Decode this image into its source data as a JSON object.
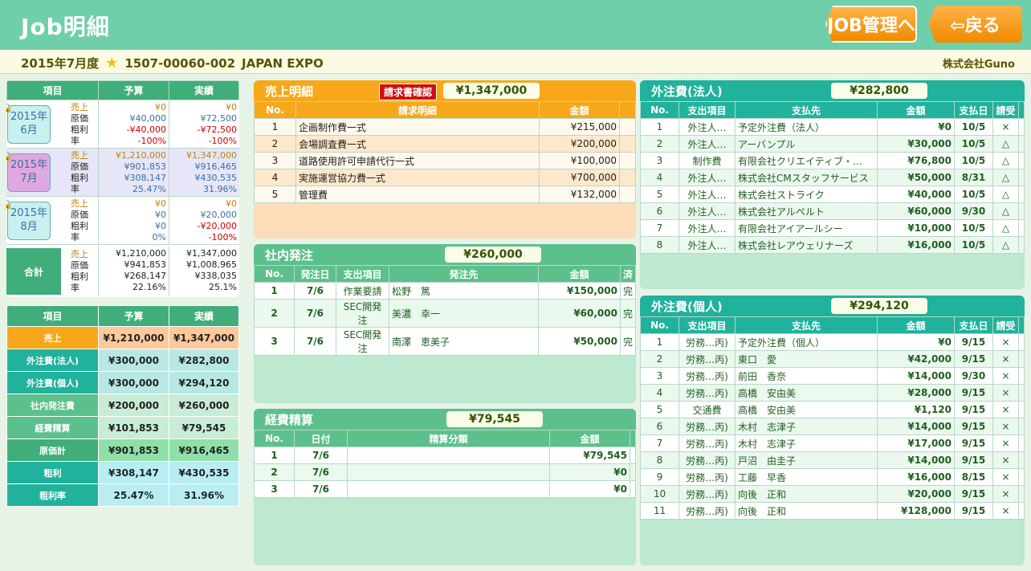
{
  "header": {
    "title": "Job明細",
    "job_button": "JOB管理へ",
    "back_button": "⇦戻る"
  },
  "subheader": {
    "period": "2015年7月度",
    "job_code": "1507-00060-002",
    "job_name": "JAPAN EXPO",
    "company": "株式会社Guno"
  },
  "month_table": {
    "headers": [
      "項目",
      "予算",
      "実績"
    ],
    "row_labels": [
      "売上",
      "原価",
      "粗利",
      "率"
    ],
    "months": [
      {
        "label": "2015年\n6月",
        "budget": [
          "¥0",
          "¥40,000",
          "-¥40,000",
          "-100%"
        ],
        "actual": [
          "¥0",
          "¥72,500",
          "-¥72,500",
          "-100%"
        ]
      },
      {
        "label": "2015年\n7月",
        "budget": [
          "¥1,210,000",
          "¥901,853",
          "¥308,147",
          "25.47%"
        ],
        "actual": [
          "¥1,347,000",
          "¥916,465",
          "¥430,535",
          "31.96%"
        ]
      },
      {
        "label": "2015年\n8月",
        "budget": [
          "¥0",
          "¥0",
          "¥0",
          "0%"
        ],
        "actual": [
          "¥0",
          "¥20,000",
          "-¥20,000",
          "-100%"
        ]
      }
    ],
    "total": {
      "label": "合計",
      "budget": [
        "¥1,210,000",
        "¥941,853",
        "¥268,147",
        "22.16%"
      ],
      "actual": [
        "¥1,347,000",
        "¥1,008,965",
        "¥338,035",
        "25.1%"
      ]
    }
  },
  "summary_table": {
    "headers": [
      "項目",
      "予算",
      "実績"
    ],
    "rows": [
      {
        "label": "売上",
        "budget": "¥1,210,000",
        "actual": "¥1,347,000"
      },
      {
        "label": "外注費(法人)",
        "budget": "¥300,000",
        "actual": "¥282,800"
      },
      {
        "label": "外注費(個人)",
        "budget": "¥300,000",
        "actual": "¥294,120"
      },
      {
        "label": "社内発注費",
        "budget": "¥200,000",
        "actual": "¥260,000"
      },
      {
        "label": "経費精算",
        "budget": "¥101,853",
        "actual": "¥79,545"
      },
      {
        "label": "原価計",
        "budget": "¥901,853",
        "actual": "¥916,465"
      },
      {
        "label": "粗利",
        "budget": "¥308,147",
        "actual": "¥430,535"
      },
      {
        "label": "粗利率",
        "budget": "25.47%",
        "actual": "31.96%"
      }
    ]
  },
  "sales": {
    "title": "売上明細",
    "invoice_button": "請求書確認",
    "total": "¥1,347,000",
    "headers": [
      "No.",
      "請求明細",
      "金額"
    ],
    "rows": [
      [
        "1",
        "企画制作費一式",
        "¥215,000"
      ],
      [
        "2",
        "会場調査費一式",
        "¥200,000"
      ],
      [
        "3",
        "道路使用許可申請代行一式",
        "¥100,000"
      ],
      [
        "4",
        "実施運営協力費一式",
        "¥700,000"
      ],
      [
        "5",
        "管理費",
        "¥132,000"
      ]
    ]
  },
  "internal": {
    "title": "社内発注",
    "total": "¥260,000",
    "headers": [
      "No.",
      "発注日",
      "支出項目",
      "発注先",
      "金額",
      "済"
    ],
    "rows": [
      [
        "1",
        "7/6",
        "作業要請",
        "松野　篤",
        "¥150,000",
        "完"
      ],
      [
        "2",
        "7/6",
        "SEC開発注",
        "美濃　幸一",
        "¥60,000",
        "完"
      ],
      [
        "3",
        "7/6",
        "SEC開発注",
        "南澤　恵美子",
        "¥50,000",
        "完"
      ]
    ]
  },
  "expense": {
    "title": "経費精算",
    "total": "¥79,545",
    "headers": [
      "No.",
      "日付",
      "精算分類",
      "金額"
    ],
    "rows": [
      [
        "1",
        "7/6",
        "",
        "¥79,545"
      ],
      [
        "2",
        "7/6",
        "",
        "¥0"
      ],
      [
        "3",
        "7/6",
        "",
        "¥0"
      ]
    ]
  },
  "corp": {
    "title": "外注費(法人)",
    "total": "¥282,800",
    "headers": [
      "No.",
      "支出項目",
      "支払先",
      "金額",
      "支払日",
      "請受"
    ],
    "rows": [
      [
        "1",
        "外注人…",
        "予定外注費（法人）",
        "¥0",
        "10/5",
        "×"
      ],
      [
        "2",
        "外注人…",
        "アーバンプル",
        "¥30,000",
        "10/5",
        "△"
      ],
      [
        "3",
        "制作費",
        "有限会社クリエイティブ・…",
        "¥76,800",
        "10/5",
        "△"
      ],
      [
        "4",
        "外注人…",
        "株式会社CMスタッフサービス",
        "¥50,000",
        "8/31",
        "△"
      ],
      [
        "5",
        "外注人…",
        "株式会社ストライク",
        "¥40,000",
        "10/5",
        "△"
      ],
      [
        "6",
        "外注人…",
        "株式会社アルペルト",
        "¥60,000",
        "9/30",
        "△"
      ],
      [
        "7",
        "外注人…",
        "有限会社アイアールシー",
        "¥10,000",
        "10/5",
        "△"
      ],
      [
        "8",
        "外注人…",
        "株式会社レアウェリナーズ",
        "¥16,000",
        "10/5",
        "△"
      ]
    ]
  },
  "indiv": {
    "title": "外注費(個人)",
    "total": "¥294,120",
    "headers": [
      "No.",
      "支出項目",
      "支払先",
      "金額",
      "支払日",
      "請受"
    ],
    "rows": [
      [
        "1",
        "労務…丙)",
        "予定外注費（個人）",
        "¥0",
        "9/15",
        "×"
      ],
      [
        "2",
        "労務…丙)",
        "東口　愛",
        "¥42,000",
        "9/15",
        "×"
      ],
      [
        "3",
        "労務…丙)",
        "前田　香奈",
        "¥14,000",
        "9/30",
        "×"
      ],
      [
        "4",
        "労務…丙)",
        "高橋　安由美",
        "¥28,000",
        "9/15",
        "×"
      ],
      [
        "5",
        "交通費",
        "高橋　安由美",
        "¥1,120",
        "9/15",
        "×"
      ],
      [
        "6",
        "労務…丙)",
        "木村　志津子",
        "¥14,000",
        "9/15",
        "×"
      ],
      [
        "7",
        "労務…丙)",
        "木村　志津子",
        "¥17,000",
        "9/15",
        "×"
      ],
      [
        "8",
        "労務…丙)",
        "戸沼　由圭子",
        "¥14,000",
        "9/15",
        "×"
      ],
      [
        "9",
        "労務…丙)",
        "工藤　早香",
        "¥16,000",
        "8/15",
        "×"
      ],
      [
        "10",
        "労務…丙)",
        "向後　正和",
        "¥20,000",
        "9/15",
        "×"
      ],
      [
        "11",
        "労務…丙)",
        "向後　正和",
        "¥128,000",
        "9/15",
        "×"
      ]
    ]
  }
}
